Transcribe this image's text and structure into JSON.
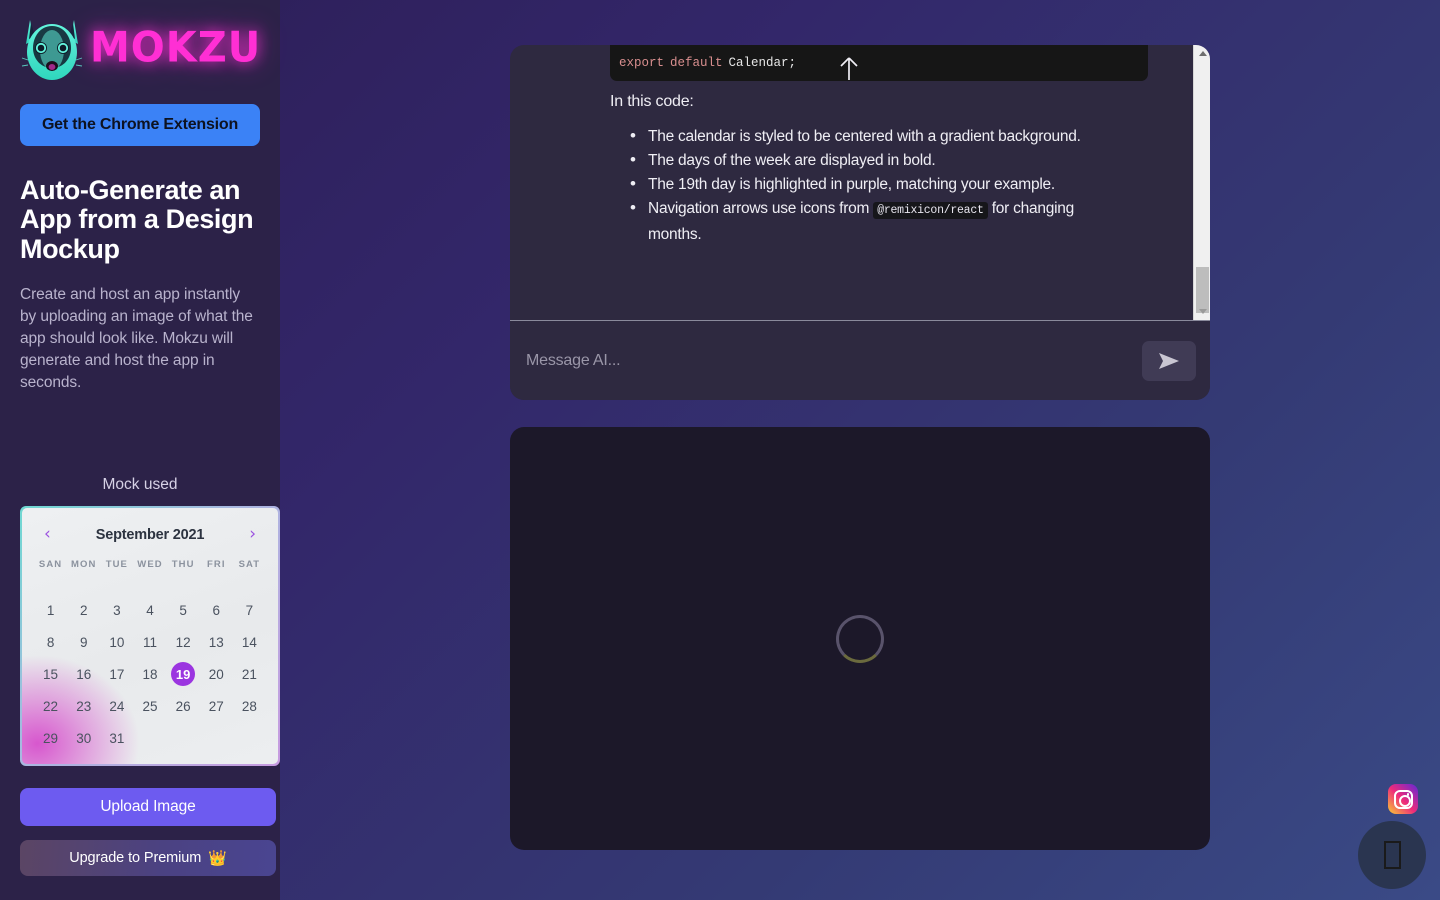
{
  "brand": {
    "name": "MOKZU",
    "logo_icon": "fox-head-logo",
    "accent_pink": "#ff2fd4",
    "accent_teal": "#45e0cf"
  },
  "sidebar": {
    "extension_button": "Get the Chrome Extension",
    "title": "Auto-Generate an App from a Design Mockup",
    "description": "Create and host an app instantly by uploading an image of what the app should look like. Mokzu will generate and host the app in seconds.",
    "mock_label": "Mock used",
    "upload_button": "Upload Image",
    "premium_button": "Upgrade to Premium",
    "premium_icon": "crown-icon"
  },
  "mock_calendar": {
    "prev_icon": "chevron-left-icon",
    "next_icon": "chevron-right-icon",
    "month": "September 2021",
    "day_headers": [
      "SAN",
      "MON",
      "TUE",
      "WED",
      "THU",
      "FRI",
      "SAT"
    ],
    "days": [
      1,
      2,
      3,
      4,
      5,
      6,
      7,
      8,
      9,
      10,
      11,
      12,
      13,
      14,
      15,
      16,
      17,
      18,
      19,
      20,
      21,
      22,
      23,
      24,
      25,
      26,
      27,
      28,
      29,
      30,
      31
    ],
    "selected_day": 19,
    "selected_color": "#9b35e0"
  },
  "chat": {
    "code_snippet": {
      "keyword1": "export",
      "keyword2": "default",
      "identifier": "Calendar;"
    },
    "arrow_icon": "up-arrow-icon",
    "intro": "In this code:",
    "bullets": [
      {
        "text": "The calendar is styled to be centered with a gradient background."
      },
      {
        "text": "The days of the week are displayed in bold."
      },
      {
        "text": "The 19th day is highlighted in purple, matching your example."
      },
      {
        "pre": "Navigation arrows use icons from",
        "code": "@remixicon/react",
        "post": "for changing months."
      }
    ],
    "scrollbar": {
      "up_icon": "scroll-up-arrow-icon",
      "down_icon": "scroll-down-arrow-icon"
    }
  },
  "composer": {
    "placeholder": "Message AI...",
    "value": "",
    "send_icon": "send-plane-icon"
  },
  "preview": {
    "status": "loading",
    "spinner_icon": "loading-spinner-icon"
  },
  "floating": {
    "instagram_icon": "instagram-icon",
    "fab_icon": "missing-glyph-icon"
  }
}
